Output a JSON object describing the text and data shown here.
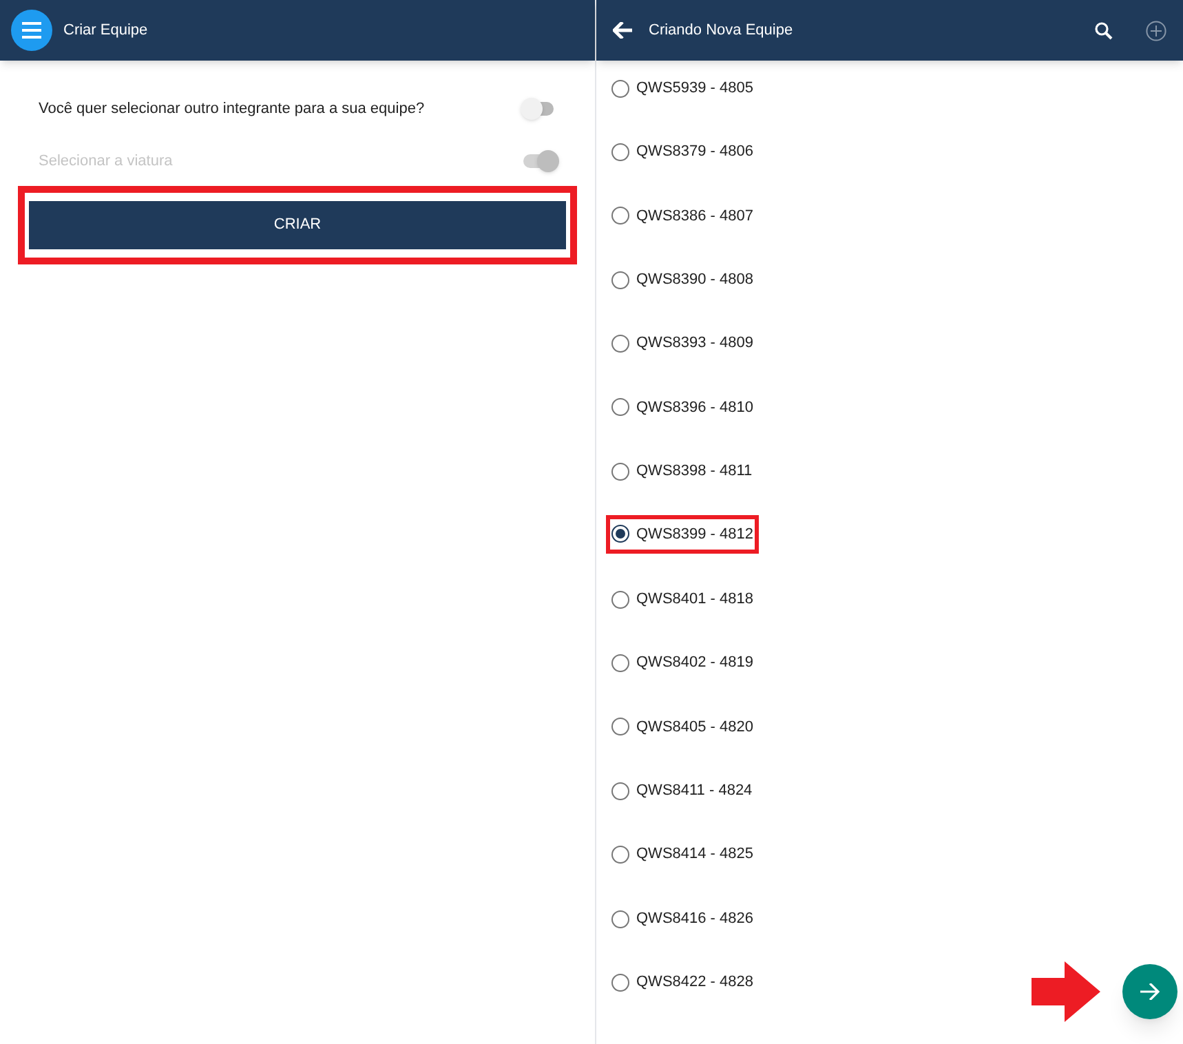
{
  "left": {
    "title": "Criar Equipe",
    "toggles": [
      {
        "label": "Você quer selecionar outro integrante para a sua equipe?",
        "on": false,
        "disabled": false
      },
      {
        "label": "Selecionar a viatura",
        "on": true,
        "disabled": true
      }
    ],
    "button": {
      "label": "CRIAR",
      "highlighted": true
    }
  },
  "right": {
    "title": "Criando Nova Equipe",
    "items": [
      {
        "label": "QWS5939 - 4805",
        "selected": false,
        "highlighted": false
      },
      {
        "label": "QWS8379 - 4806",
        "selected": false,
        "highlighted": false
      },
      {
        "label": "QWS8386 - 4807",
        "selected": false,
        "highlighted": false
      },
      {
        "label": "QWS8390 - 4808",
        "selected": false,
        "highlighted": false
      },
      {
        "label": "QWS8393 - 4809",
        "selected": false,
        "highlighted": false
      },
      {
        "label": "QWS8396 - 4810",
        "selected": false,
        "highlighted": false
      },
      {
        "label": "QWS8398 - 4811",
        "selected": false,
        "highlighted": false
      },
      {
        "label": "QWS8399 - 4812",
        "selected": true,
        "highlighted": true
      },
      {
        "label": "QWS8401 - 4818",
        "selected": false,
        "highlighted": false
      },
      {
        "label": "QWS8402 - 4819",
        "selected": false,
        "highlighted": false
      },
      {
        "label": "QWS8405 - 4820",
        "selected": false,
        "highlighted": false
      },
      {
        "label": "QWS8411 - 4824",
        "selected": false,
        "highlighted": false
      },
      {
        "label": "QWS8414 - 4825",
        "selected": false,
        "highlighted": false
      },
      {
        "label": "QWS8416 - 4826",
        "selected": false,
        "highlighted": false
      },
      {
        "label": "QWS8422 - 4828",
        "selected": false,
        "highlighted": false
      }
    ],
    "fab": {
      "pointed": true
    }
  }
}
